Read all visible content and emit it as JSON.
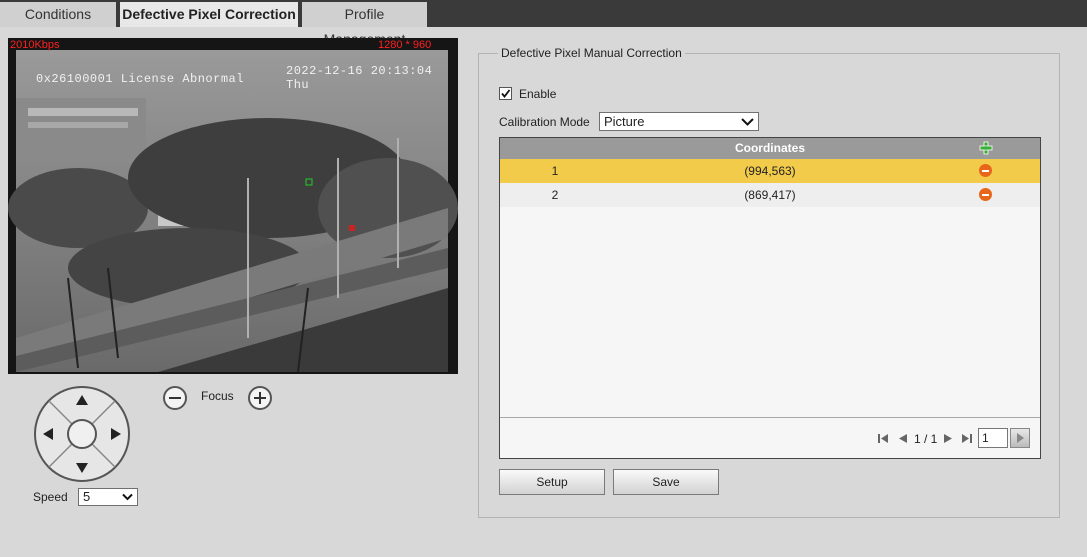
{
  "tabs": [
    {
      "label": "Conditions",
      "active": false
    },
    {
      "label": "Defective Pixel Correction",
      "active": true
    },
    {
      "label": "Profile Management",
      "active": false
    }
  ],
  "video": {
    "bitrate": "2010Kbps",
    "resolution": "1280 * 960",
    "osd_text": "0x26100001   License Abnormal",
    "timestamp": "2022-12-16 20:13:04 Thu"
  },
  "ptz": {
    "focus_label": "Focus",
    "speed_label": "Speed",
    "speed_value": "5"
  },
  "panel": {
    "title": "Defective Pixel Manual Correction",
    "enable_label": "Enable",
    "enable_checked": true,
    "calibration_label": "Calibration Mode",
    "calibration_value": "Picture"
  },
  "table": {
    "column_header": "Coordinates",
    "rows": [
      {
        "index": "1",
        "coords": "(994,563)"
      },
      {
        "index": "2",
        "coords": "(869,417)"
      }
    ],
    "page_info": "1 / 1",
    "page_input": "1"
  },
  "buttons": {
    "setup": "Setup",
    "save": "Save"
  },
  "icons": {
    "add": "plus-icon",
    "delete": "minus-circle-icon",
    "first": "first-page-icon",
    "prev": "prev-page-icon",
    "next": "next-page-icon",
    "last": "last-page-icon",
    "go": "go-arrow-icon"
  },
  "colors": {
    "selected_row": "#f2cb4a",
    "delete_icon": "#e8661a",
    "add_icon": "#3cae3c",
    "osd_red": "#ff2020"
  }
}
